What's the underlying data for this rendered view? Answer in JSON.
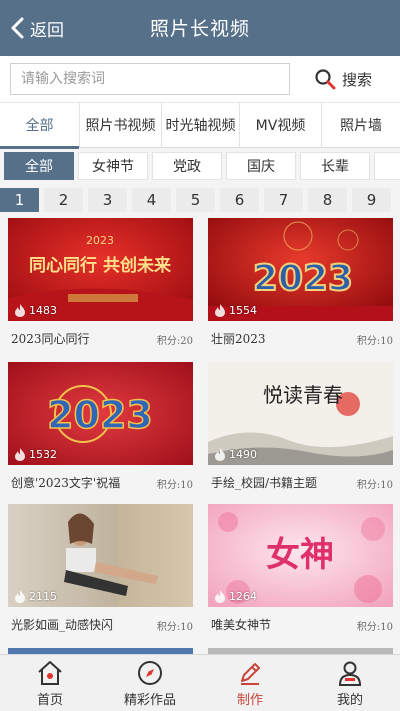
{
  "header": {
    "back_label": "返回",
    "title": "照片长视频"
  },
  "search": {
    "placeholder": "请输入搜索词",
    "button_label": "搜索"
  },
  "main_tabs": [
    {
      "label": "全部",
      "active": true
    },
    {
      "label": "照片书视频",
      "active": false
    },
    {
      "label": "时光轴视频",
      "active": false
    },
    {
      "label": "MV视频",
      "active": false
    },
    {
      "label": "照片墙",
      "active": false
    }
  ],
  "chips": [
    {
      "label": "全部",
      "active": true
    },
    {
      "label": "女神节",
      "active": false
    },
    {
      "label": "党政",
      "active": false
    },
    {
      "label": "国庆",
      "active": false
    },
    {
      "label": "长辈",
      "active": false
    },
    {
      "label": "",
      "active": false
    }
  ],
  "pages": [
    {
      "label": "1",
      "active": true
    },
    {
      "label": "2",
      "active": false
    },
    {
      "label": "3",
      "active": false
    },
    {
      "label": "4",
      "active": false
    },
    {
      "label": "5",
      "active": false
    },
    {
      "label": "6",
      "active": false
    },
    {
      "label": "7",
      "active": false
    },
    {
      "label": "8",
      "active": false
    },
    {
      "label": "9",
      "active": false
    }
  ],
  "cards": [
    {
      "title": "2023同心同行",
      "score": "积分:20",
      "count": "1483",
      "thumb_text": "同心同行 共创未来",
      "thumb_sub": "2023"
    },
    {
      "title": "壮丽2023",
      "score": "积分:10",
      "count": "1554",
      "thumb_text": "2023"
    },
    {
      "title": "创意'2023文字'祝福",
      "score": "积分:10",
      "count": "1532",
      "thumb_text": "2023"
    },
    {
      "title": "手绘_校园/书籍主题",
      "score": "积分:10",
      "count": "1490",
      "thumb_text": "悦读青春"
    },
    {
      "title": "光影如画_动感快闪",
      "score": "积分:10",
      "count": "2115"
    },
    {
      "title": "唯美女神节",
      "score": "积分:10",
      "count": "1264",
      "thumb_text": "女神"
    }
  ],
  "bottom_nav": [
    {
      "label": "首页",
      "icon": "home-icon",
      "active": false
    },
    {
      "label": "精彩作品",
      "icon": "compass-icon",
      "active": false
    },
    {
      "label": "制作",
      "icon": "pencil-icon",
      "active": true
    },
    {
      "label": "我的",
      "icon": "user-icon",
      "active": false
    }
  ],
  "colors": {
    "primary": "#56708a",
    "active_nav": "#c8453c"
  }
}
